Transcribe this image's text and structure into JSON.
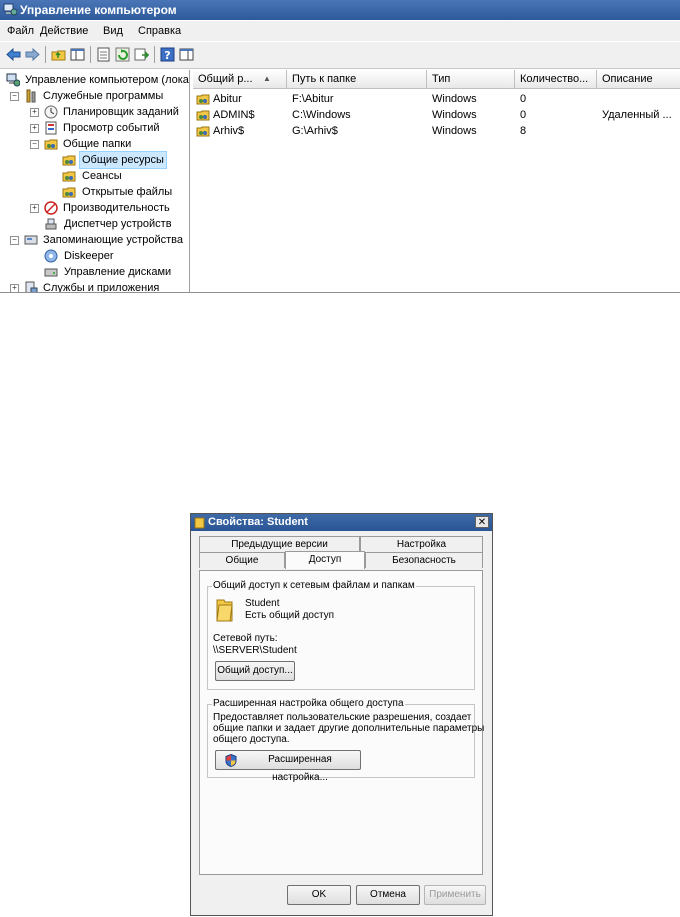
{
  "window": {
    "title": "Управление компьютером",
    "menu": [
      "Файл",
      "Действие",
      "Вид",
      "Справка"
    ]
  },
  "tree": {
    "items": [
      {
        "label": "Управление компьютером (лока",
        "icon": "computer-management-icon"
      },
      {
        "label": "Служебные программы",
        "icon": "tools-icon"
      },
      {
        "label": "Планировщик заданий",
        "icon": "clock-icon"
      },
      {
        "label": "Просмотр событий",
        "icon": "event-viewer-icon"
      },
      {
        "label": "Общие папки",
        "icon": "shared-folder-icon"
      },
      {
        "label": "Общие ресурсы",
        "icon": "shared-folder-icon"
      },
      {
        "label": "Сеансы",
        "icon": "shared-folder-icon"
      },
      {
        "label": "Открытые файлы",
        "icon": "shared-folder-icon"
      },
      {
        "label": "Производительность",
        "icon": "performance-icon"
      },
      {
        "label": "Диспетчер устройств",
        "icon": "device-manager-icon"
      },
      {
        "label": "Запоминающие устройства",
        "icon": "storage-icon"
      },
      {
        "label": "Diskeeper",
        "icon": "diskeeper-icon"
      },
      {
        "label": "Управление дисками",
        "icon": "disk-icon"
      },
      {
        "label": "Службы и приложения",
        "icon": "services-icon"
      }
    ]
  },
  "list": {
    "columns": [
      "Общий р...",
      "Путь к папке",
      "Тип",
      "Количество...",
      "Описание"
    ],
    "rows": [
      {
        "name": "Abitur",
        "path": "F:\\Abitur",
        "type": "Windows",
        "count": "0",
        "desc": ""
      },
      {
        "name": "ADMIN$",
        "path": "C:\\Windows",
        "type": "Windows",
        "count": "0",
        "desc": "Удаленный ..."
      },
      {
        "name": "Arhiv$",
        "path": "G:\\Arhiv$",
        "type": "Windows",
        "count": "8",
        "desc": ""
      }
    ]
  },
  "dialog": {
    "title": "Свойства: Student",
    "close": "✕",
    "tabs_top": [
      "Предыдущие версии",
      "Настройка"
    ],
    "tabs_bottom": [
      "Общие",
      "Доступ",
      "Безопасность"
    ],
    "group1_label": "Общий доступ к сетевым файлам и папкам",
    "folder_name": "Student",
    "folder_status": "Есть общий доступ",
    "net_path_label": "Сетевой путь:",
    "net_path": "\\\\SERVER\\Student",
    "share_button": "Общий доступ...",
    "group2_label": "Расширенная настройка общего доступа",
    "group2_text": [
      "Предоставляет пользовательские разрешения, создает",
      "общие папки и задает другие дополнительные параметры",
      "общего доступа."
    ],
    "advanced_button": "Расширенная настройка...",
    "ok": "OK",
    "cancel": "Отмена",
    "apply": "Применить"
  }
}
